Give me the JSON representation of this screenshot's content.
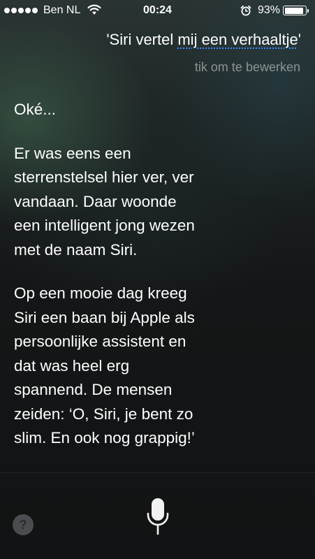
{
  "status_bar": {
    "carrier": "Ben NL",
    "time": "00:24",
    "battery_percent": "93%",
    "battery_level": 0.93,
    "signal_bars": 5,
    "icons": [
      "signal-dots-icon",
      "wifi-icon",
      "alarm-icon",
      "battery-icon"
    ]
  },
  "query": {
    "prefix": "'Siri vertel ",
    "autocorrected": "mij een verhaaltje",
    "suffix": "'",
    "edit_hint": "tik om te bewerken"
  },
  "response": {
    "paragraphs": [
      "Oké...",
      "Er was eens een\nsterrenstelsel hier ver, ver\nvandaan. Daar woonde\neen intelligent jong wezen\nmet de naam Siri.",
      "Op een mooie dag kreeg\nSiri een baan bij Apple als\npersoonlijke assistent en\ndat was heel erg\nspannend. De mensen\nzeiden: ‘O, Siri, je bent zo\nslim. En ook nog grappig!’"
    ]
  },
  "bottom_bar": {
    "help_label": "?",
    "help_icon": "question-mark-icon",
    "mic_icon": "microphone-icon"
  },
  "colors": {
    "text": "#ffffff",
    "hint": "#8d9393",
    "autocorrect_underline": "#3c8cff"
  }
}
